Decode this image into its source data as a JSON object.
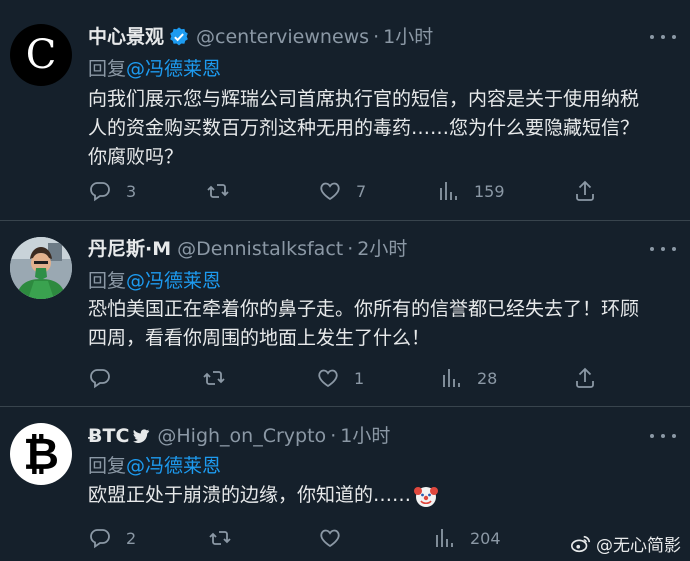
{
  "tweets": [
    {
      "name": "中心景观",
      "verified": true,
      "handle": "@centerviewnews",
      "dot": "·",
      "time": "1小时",
      "reply_prefix": "回复",
      "reply_to": "@冯德莱恩",
      "text_lines": [
        "向我们展示您与辉瑞公司首席执行官的短信，内容是关于使用纳税",
        "人的资金购买数百万剂这种无用的毒药……您为什么要隐藏短信？",
        "你腐败吗？"
      ],
      "replies": "3",
      "retweets": "",
      "likes": "7",
      "views": "159",
      "avatar_letter": "C"
    },
    {
      "name": "丹尼斯·M",
      "verified": false,
      "handle": "@Dennistalksfact",
      "dot": "·",
      "time": "2小时",
      "reply_prefix": "回复",
      "reply_to": "@冯德莱恩",
      "text_lines": [
        "恐怕美国正在牵着你的鼻子走。你所有的信誉都已经失去了！环顾",
        "四周，看看你周围的地面上发生了什么！"
      ],
      "replies": "",
      "retweets": "",
      "likes": "1",
      "views": "28"
    },
    {
      "name": "ɃTC",
      "verified": false,
      "handle": "@High_on_Crypto",
      "dot": "·",
      "time": "1小时",
      "reply_prefix": "回复",
      "reply_to": "@冯德莱恩",
      "text_lines": [
        "欧盟正处于崩溃的边缘，你知道的……"
      ],
      "replies": "2",
      "retweets": "",
      "likes": "",
      "views": "204",
      "avatar_letter": "₿"
    }
  ],
  "watermark": {
    "text": "@无心简影"
  },
  "colors": {
    "background": "#15202b",
    "accent": "#1d9bf0",
    "muted": "#8b98a5"
  }
}
